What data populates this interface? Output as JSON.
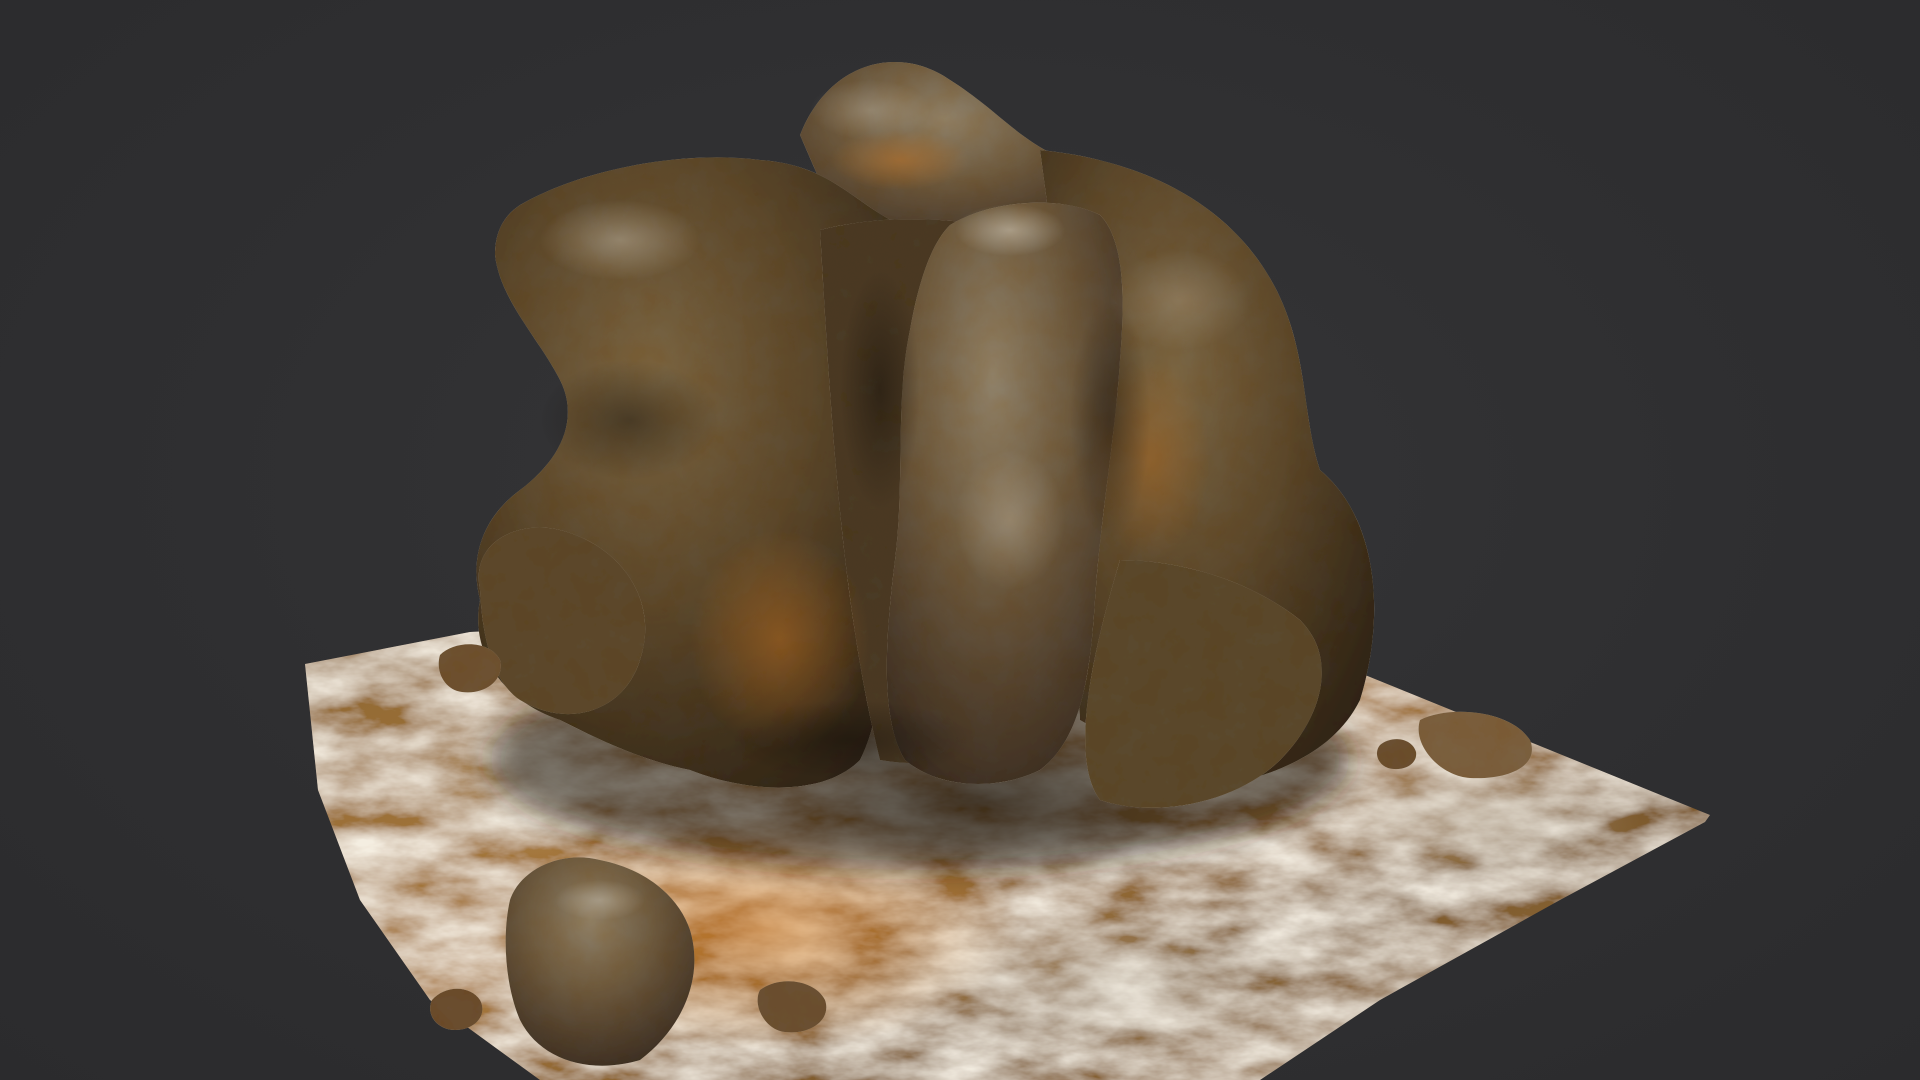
{
  "scene": {
    "subject": "rock-formation-3d-model",
    "background_color": "#2f2f31",
    "palette": {
      "ground_base": "#8a6432",
      "ground_light": "#b9894a",
      "rust": "#c06f22",
      "moss": "#5a4a26",
      "rock_dark": "#3b3022",
      "rock_mid": "#6b5538",
      "rock_light": "#9a8a72",
      "highlight": "#cfc6b4",
      "shadow": "#1a140d"
    }
  }
}
